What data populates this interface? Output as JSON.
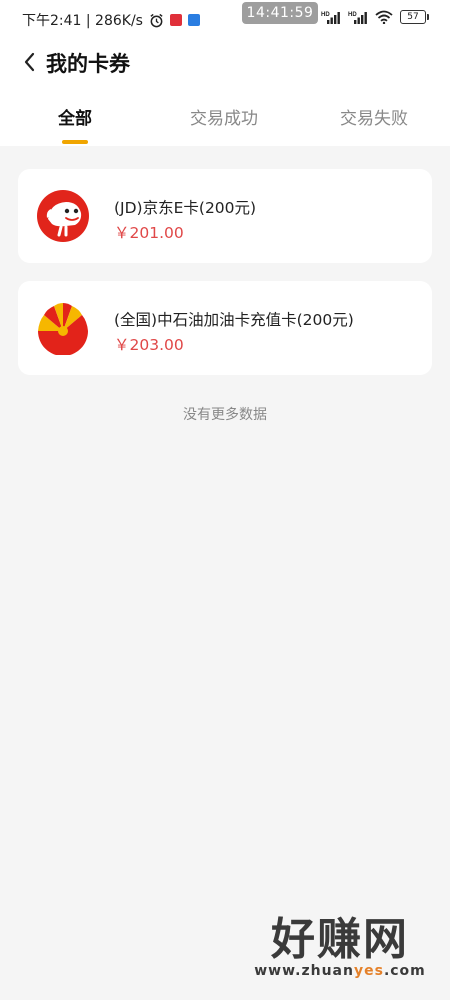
{
  "status_bar": {
    "left_text": "下午2:41 | 286K/s",
    "time_pill": "14:41:59",
    "battery": "57"
  },
  "header": {
    "title": "我的卡券"
  },
  "tabs": [
    {
      "label": "全部",
      "active": true
    },
    {
      "label": "交易成功",
      "active": false
    },
    {
      "label": "交易失败",
      "active": false
    }
  ],
  "cards": [
    {
      "name": "(JD)京东E卡(200元)",
      "price": "￥201.00",
      "logo": "jd-dog-logo"
    },
    {
      "name": "(全国)中石油加油卡充值卡(200元)",
      "price": "￥203.00",
      "logo": "petrochina-logo"
    }
  ],
  "footer_note": "没有更多数据",
  "watermark": {
    "brand": "好赚网",
    "domain_pre": "www.zhuan",
    "domain_highlight": "yes",
    "domain_post": ".com"
  },
  "colors": {
    "accent": "#f0a500",
    "price": "#e04848",
    "background": "#f5f5f5"
  }
}
